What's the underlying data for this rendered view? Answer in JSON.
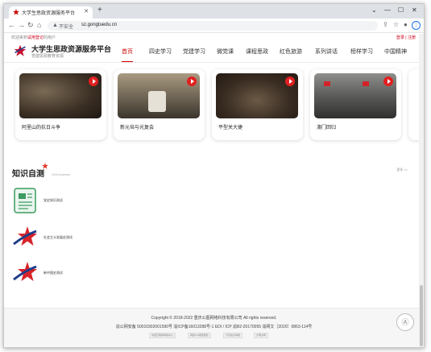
{
  "browser": {
    "tab_title": "大学生思政资源服务平台",
    "url": "sz.gongtuedu.cn",
    "insecure_label": "不安全"
  },
  "page": {
    "welcome_prefix": "欢迎来到",
    "welcome_link": "试用登记",
    "welcome_suffix": "的用户",
    "login_link": "登录 | 注册",
    "site_title": "大学生思政资源服务平台",
    "site_subtitle": "党建思政教育资源",
    "nav": [
      "首页",
      "四史学习",
      "党建学习",
      "微党课",
      "课程思政",
      "红色旅游",
      "系列讲话",
      "榜样学习",
      "中国精神"
    ],
    "videos": [
      {
        "title": "阿里山的抗日斗争"
      },
      {
        "title": "新元培与光复会"
      },
      {
        "title": "平型关大捷"
      },
      {
        "title": "澳门回归"
      }
    ],
    "selftest_title": "知识自测",
    "selftest_en": "Self-examine",
    "more_link": "更多 >>",
    "selftests": [
      {
        "label": "党史知识测试",
        "icon": "exam-paper-icon"
      },
      {
        "label": "社会主义发展史测试",
        "icon": "red-star-icon"
      },
      {
        "label": "新中国史测试",
        "icon": "red-star-icon"
      }
    ],
    "footer": {
      "copyright": "Copyright © 2018-2022 重庆公图网络科技有限公司 All rights reserved.",
      "icp": "渝公网安备 50010302001590号 渝ICP备16013288号-1 EDI / ICP 渝B2-20170055 渝网文［2020］0863-114号",
      "badges": [
        "中国互联网举报中心",
        "网络110报警服务",
        "不良信息举报",
        "文明办网"
      ]
    }
  },
  "colors": {
    "accent": "#c00000",
    "link_blue": "#1b5aa6"
  }
}
